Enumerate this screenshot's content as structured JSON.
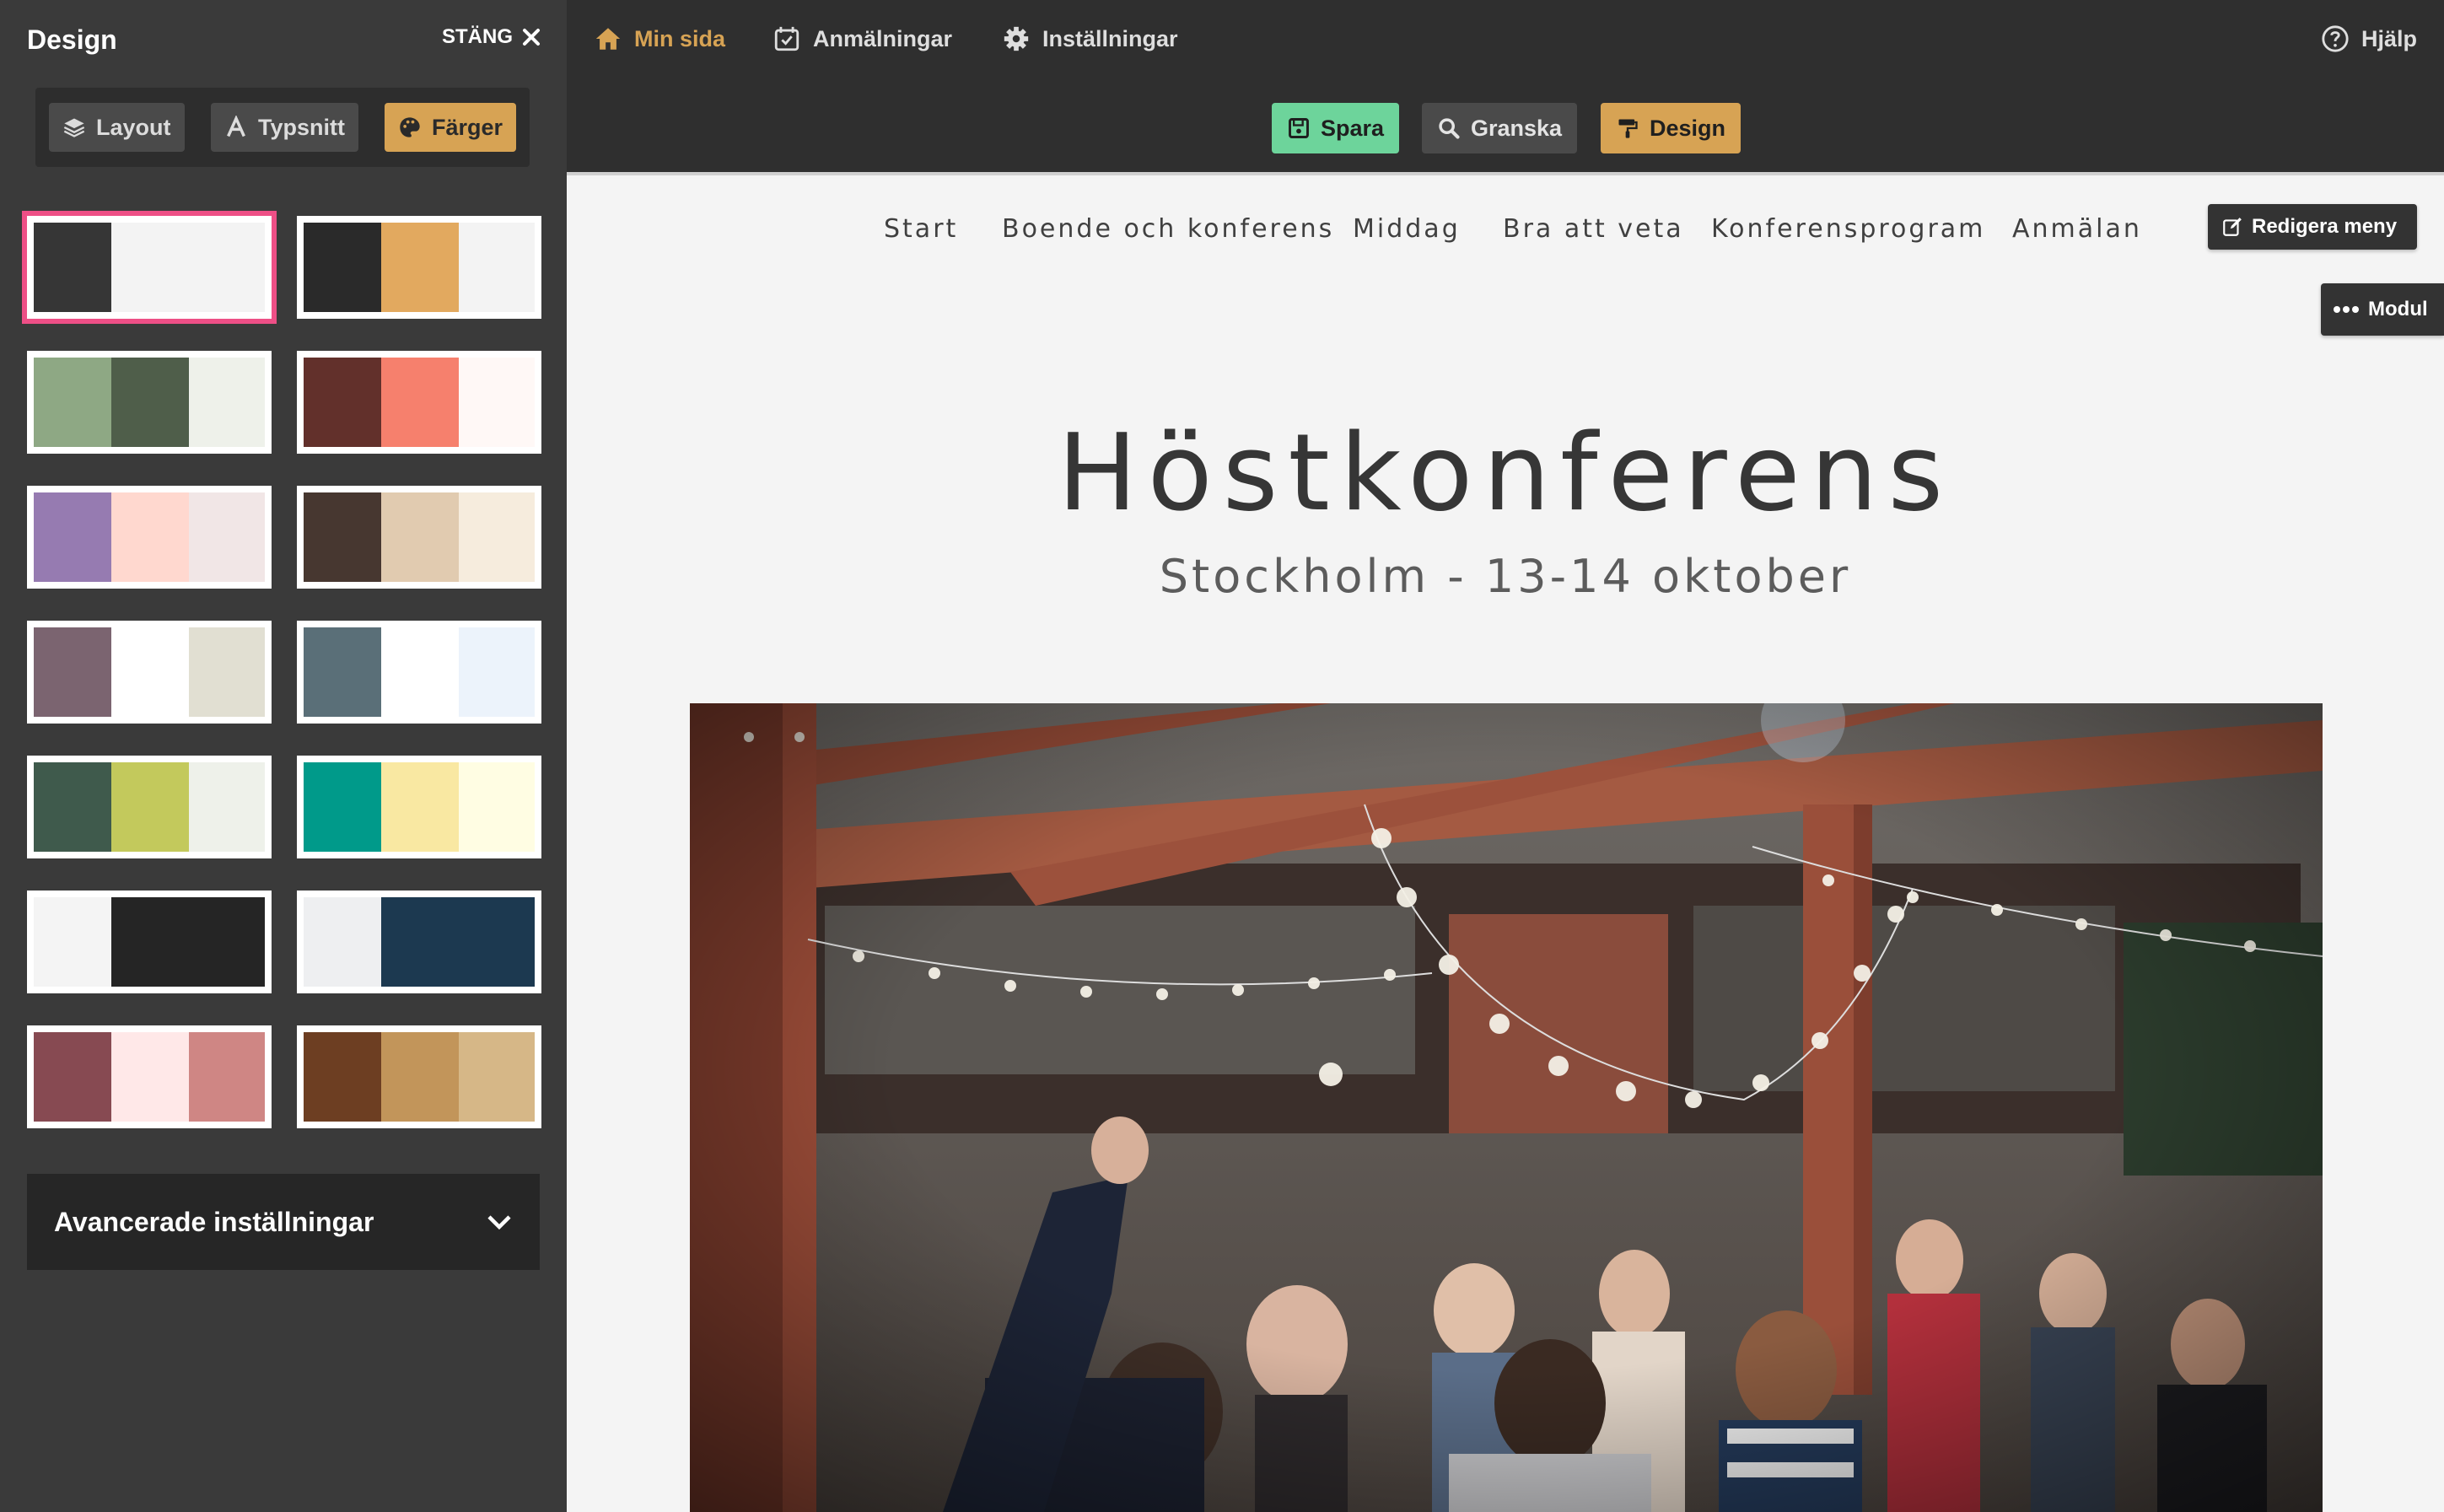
{
  "sidebar": {
    "title": "Design",
    "close_label": "STÄNG",
    "tabs": [
      {
        "label": "Layout",
        "icon": "layers-icon"
      },
      {
        "label": "Typsnitt",
        "icon": "font-icon"
      },
      {
        "label": "Färger",
        "icon": "palette-icon",
        "active": true
      }
    ],
    "palettes": [
      [
        "#363636",
        "#f3f3f3",
        "#f3f3f3"
      ],
      [
        "#2a2a2a",
        "#e2a95f",
        "#f3f3f3"
      ],
      [
        "#8ea884",
        "#4f5e4a",
        "#eef1ea"
      ],
      [
        "#62302b",
        "#f6806d",
        "#fff8f6"
      ],
      [
        "#967bb1",
        "#ffd8cf",
        "#f1e6e6"
      ],
      [
        "#473730",
        "#e1cbb0",
        "#f6ecdd"
      ],
      [
        "#7b6470",
        "#ffffff",
        "#e1dfd2"
      ],
      [
        "#5a6f78",
        "#ffffff",
        "#ecf3fb"
      ],
      [
        "#3f5a4c",
        "#c3c95c",
        "#eef1ea"
      ],
      [
        "#009a8a",
        "#f9e8a2",
        "#fffde3"
      ],
      [
        "#f4f4f4",
        "#252525",
        "#252525"
      ],
      [
        "#eeeff1",
        "#1c3950",
        "#1c3950"
      ],
      [
        "#874a52",
        "#ffe8e8",
        "#cf8684"
      ],
      [
        "#6d3e22",
        "#c2955a",
        "#d6b787"
      ]
    ],
    "advanced_label": "Avancerade inställningar"
  },
  "topbar": {
    "nav": [
      {
        "label": "Min sida",
        "icon": "home-icon",
        "active": true
      },
      {
        "label": "Anmälningar",
        "icon": "calendar-check-icon"
      },
      {
        "label": "Inställningar",
        "icon": "gear-icon"
      }
    ],
    "help_label": "Hjälp",
    "actions": {
      "save": "Spara",
      "preview": "Granska",
      "design": "Design"
    }
  },
  "site": {
    "menu": [
      "Start",
      "Boende och konferens",
      "Middag",
      "Bra att veta",
      "Konferensprogram",
      "Anmälan"
    ],
    "edit_menu_label": "Redigera meny",
    "module_label": "Modul",
    "title": "Höstkonferens",
    "subtitle": "Stockholm - 13-14 oktober"
  },
  "colors": {
    "accent_gold": "#d7a354",
    "save_green": "#6dd49b",
    "selected_pink": "#ee4f86"
  }
}
